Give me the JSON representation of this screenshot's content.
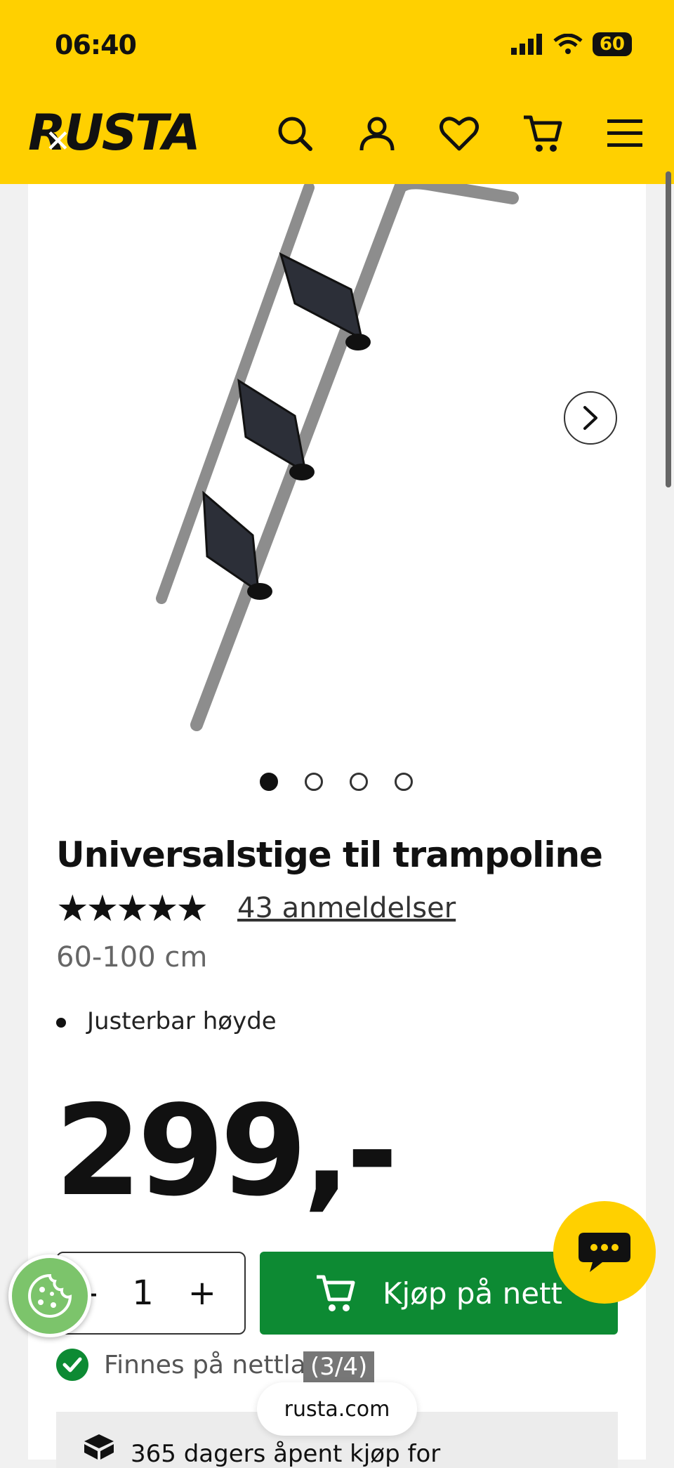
{
  "status_bar": {
    "time": "06:40",
    "battery": "60"
  },
  "header": {
    "logo": "RUSTA",
    "close": "✕"
  },
  "gallery": {
    "dots": [
      true,
      false,
      false,
      false
    ]
  },
  "product": {
    "title": "Universalstige til trampoline",
    "rating": 4.5,
    "stars": "★★★★★",
    "reviews": "43 anmeldelser",
    "size": "60-100 cm",
    "features": [
      "Justerbar høyde"
    ],
    "price": "299,-"
  },
  "purchase": {
    "qty_minus": "-",
    "qty_value": "1",
    "qty_plus": "+",
    "buy_label": "Kjøp på nett",
    "stock_label": "Finnes på nettlager"
  },
  "browser": {
    "page_counter": "(3/4)",
    "url": "rusta.com"
  },
  "info": {
    "text": "365 dagers åpent kjøp for"
  },
  "colors": {
    "brand_yellow": "#ffd000",
    "buy_green": "#0d8a33"
  }
}
